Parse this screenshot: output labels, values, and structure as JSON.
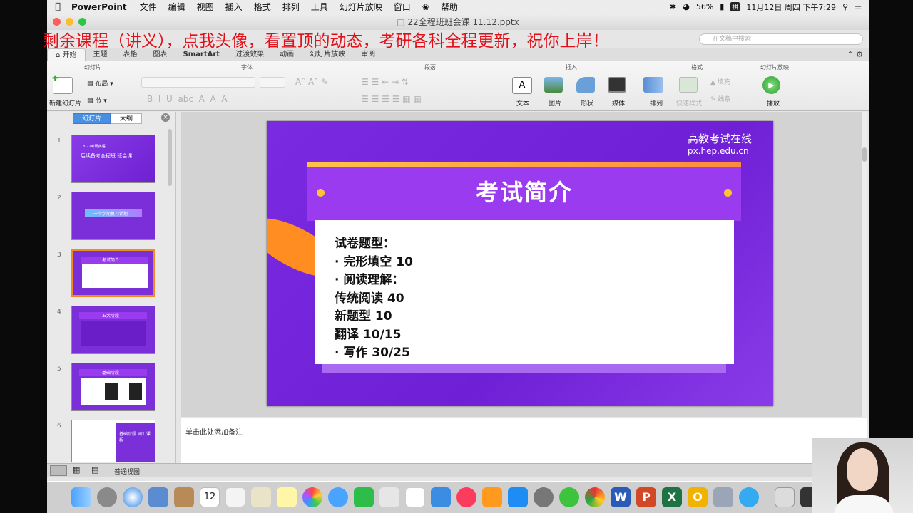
{
  "menubar": {
    "app": "PowerPoint",
    "items": [
      "文件",
      "编辑",
      "视图",
      "插入",
      "格式",
      "排列",
      "工具",
      "幻灯片放映",
      "窗口",
      "帮助"
    ],
    "battery": "56%",
    "ime": "拼",
    "datetime": "11月12日 周四 下午7:29"
  },
  "window": {
    "title": "22全程班班会课 11.12.pptx"
  },
  "overlay": {
    "promo": "剩余课程（讲义），点我头像，看置顶的动态，考研各科全程更新，祝你上岸！"
  },
  "search": {
    "placeholder": "在文稿中搜索"
  },
  "tabs": [
    "开始",
    "主题",
    "表格",
    "图表",
    "SmartArt",
    "过渡效果",
    "动画",
    "幻灯片放映",
    "审阅"
  ],
  "ribbon": {
    "groups": {
      "slides": "幻灯片",
      "font": "字体",
      "paragraph": "段落",
      "insert": "插入",
      "format": "格式",
      "slideshow": "幻灯片放映"
    },
    "new_slide": "新建幻灯片",
    "layout": "布局",
    "section": "节",
    "text": "文本",
    "picture": "图片",
    "shape": "形状",
    "media": "媒体",
    "arrange": "排列",
    "quick_styles": "快速样式",
    "fill": "填充",
    "line": "线条",
    "play": "播放"
  },
  "leftpane": {
    "tab_slides": "幻灯片",
    "tab_outline": "大纲",
    "thumbs": [
      {
        "num": "1",
        "lines": [
          "2022考研英语",
          "后续备考全程班 班会课"
        ]
      },
      {
        "num": "2",
        "lines": [
          "一个学期复习计划"
        ]
      },
      {
        "num": "3",
        "lines": [
          "考试简介"
        ]
      },
      {
        "num": "4",
        "lines": [
          "五大阶段"
        ]
      },
      {
        "num": "5",
        "lines": [
          "基础阶段"
        ]
      },
      {
        "num": "6",
        "lines": [
          "基础阶段 词汇课程"
        ]
      }
    ]
  },
  "slide": {
    "logo": "高教考试在线",
    "logo_url": "px.hep.edu.cn",
    "title": "考试简介",
    "lines": [
      "试卷题型：",
      "· 完形填空 10",
      "· 阅读理解：",
      "传统阅读 40",
      "新题型 10",
      "翻译 10/15",
      "· 写作 30/25"
    ]
  },
  "notes": {
    "placeholder": "单击此处添加备注"
  },
  "status": {
    "view": "普通视图"
  },
  "dock": {
    "calendar_day": "12"
  },
  "colors": {
    "slide_bg": "#7a2ae0",
    "banner": "#9b3bf0",
    "accent_orange": "#ff8d22",
    "promo_red": "#e20e18"
  }
}
